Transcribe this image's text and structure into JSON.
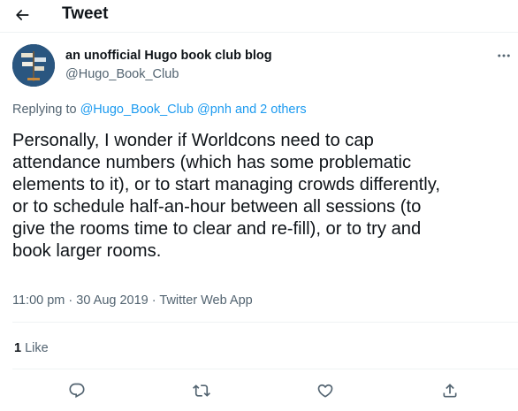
{
  "header": {
    "title": "Tweet"
  },
  "tweet": {
    "author": {
      "name": "an unofficial Hugo book club blog",
      "handle": "@Hugo_Book_Club"
    },
    "replying_to": {
      "prefix": "Replying to",
      "mention_1": "@Hugo_Book_Club",
      "mention_2": "@pnh",
      "others": "and 2 others"
    },
    "text_lines": [
      "Personally, I wonder if Worldcons need to cap",
      "attendance numbers (which has some problematic",
      "elements to it), or to start managing crowds differently,",
      "or to schedule half-an-hour between all sessions (to",
      "give the rooms time to clear and re-fill), or to try and",
      "book larger rooms."
    ],
    "time": "11:00 pm",
    "date": "30 Aug 2019",
    "separator": "·",
    "source": "Twitter Web App",
    "likes": {
      "count": "1",
      "label": "Like"
    }
  },
  "icons": {
    "back": "arrow-left-icon",
    "more": "more-horizontal-icon",
    "reply": "reply-icon",
    "retweet": "retweet-icon",
    "like": "heart-icon",
    "share": "share-icon"
  },
  "colors": {
    "accent": "#1d9bf0",
    "text": "#0f1419",
    "secondary": "#536471",
    "border": "#eff3f4"
  }
}
